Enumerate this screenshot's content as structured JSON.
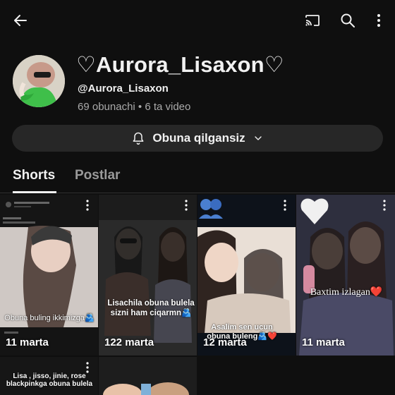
{
  "channel": {
    "name": "♡Aurora_Lisaxon♡",
    "handle": "@Aurora_Lisaxon",
    "stats": "69 obunachi • 6 ta video"
  },
  "subscribe_button": {
    "label": "Obuna qilgansiz"
  },
  "tabs": [
    {
      "label": "Shorts",
      "active": true
    },
    {
      "label": "Postlar",
      "active": false
    }
  ],
  "shorts": [
    {
      "views": "11 marta",
      "caption": "Obuna buling ikkimizga🫂"
    },
    {
      "views": "122 marta",
      "caption": "Lisachila obuna bulela sizni ham ciqarmn🫂"
    },
    {
      "views": "12 marta",
      "caption": "Asalim sen ucun obuna buleng🫂❤️"
    },
    {
      "views": "11 marta",
      "caption": "Baxtim izlagan❤️"
    },
    {
      "views": "",
      "caption": "Lisa , jisso, jinie, rose blackpinkga obuna bulela"
    },
    {
      "views": "",
      "caption": ""
    }
  ],
  "colors": {
    "background": "#0f0f0f",
    "button_bg": "#272727",
    "secondary_text": "#aaaaaa"
  }
}
